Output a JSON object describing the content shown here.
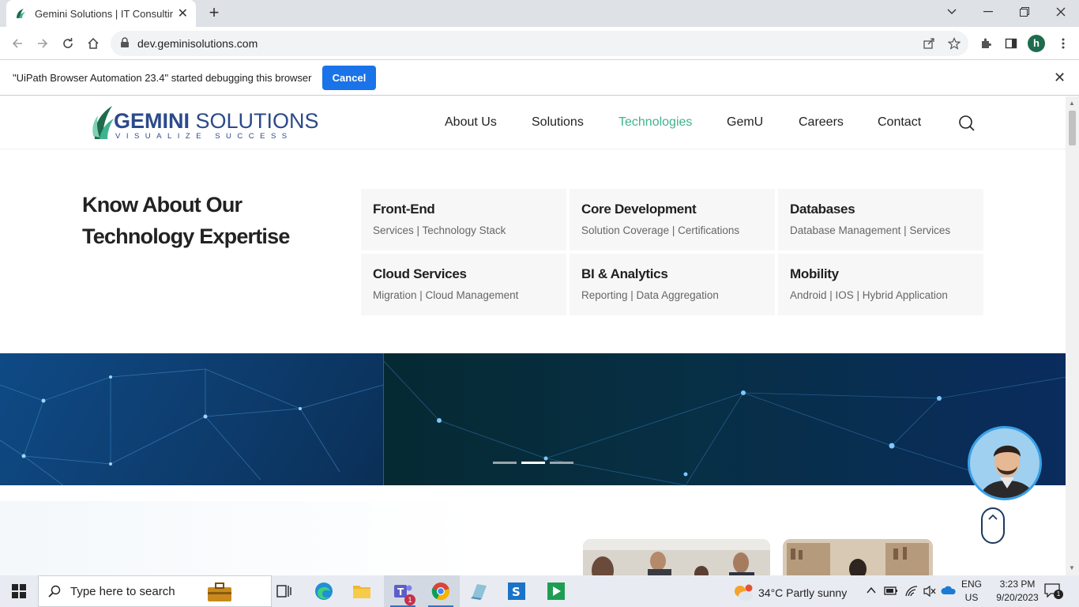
{
  "browser": {
    "tab_title": "Gemini Solutions | IT Consulting",
    "new_tab": "+",
    "url": "dev.geminisolutions.com",
    "profile_initial": "h"
  },
  "infobar": {
    "message": "\"UiPath Browser Automation 23.4\" started debugging this browser",
    "cancel_label": "Cancel",
    "close": "✕"
  },
  "site": {
    "logo_brand_bold": "GEMINI",
    "logo_brand_rest": " SOLUTIONS",
    "logo_tagline": "VISUALIZE SUCCESS",
    "nav": [
      "About Us",
      "Solutions",
      "Technologies",
      "GemU",
      "Careers",
      "Contact"
    ],
    "active_nav": "Technologies",
    "accent_color": "#3fb28f"
  },
  "mega_menu": {
    "headline": "Know About Our Technology Expertise",
    "cards": [
      {
        "title": "Front-End",
        "subtitle": "Services | Technology Stack"
      },
      {
        "title": "Core Development",
        "subtitle": "Solution Coverage | Certifications"
      },
      {
        "title": "Databases",
        "subtitle": "Database Management | Services"
      },
      {
        "title": "Cloud Services",
        "subtitle": "Migration | Cloud Management"
      },
      {
        "title": "BI & Analytics",
        "subtitle": "Reporting | Data Aggregation"
      },
      {
        "title": "Mobility",
        "subtitle": "Android | IOS | Hybrid Application"
      }
    ]
  },
  "hero": {
    "slide_count": 3,
    "active_slide": 2
  },
  "taskbar": {
    "search_placeholder": "Type here to search",
    "weather_temp": "34°C",
    "weather_text": "Partly sunny",
    "teams_badge": "1",
    "lang_top": "ENG",
    "lang_bottom": "US",
    "time": "3:23 PM",
    "date": "9/20/2023",
    "notification_count": "1"
  }
}
